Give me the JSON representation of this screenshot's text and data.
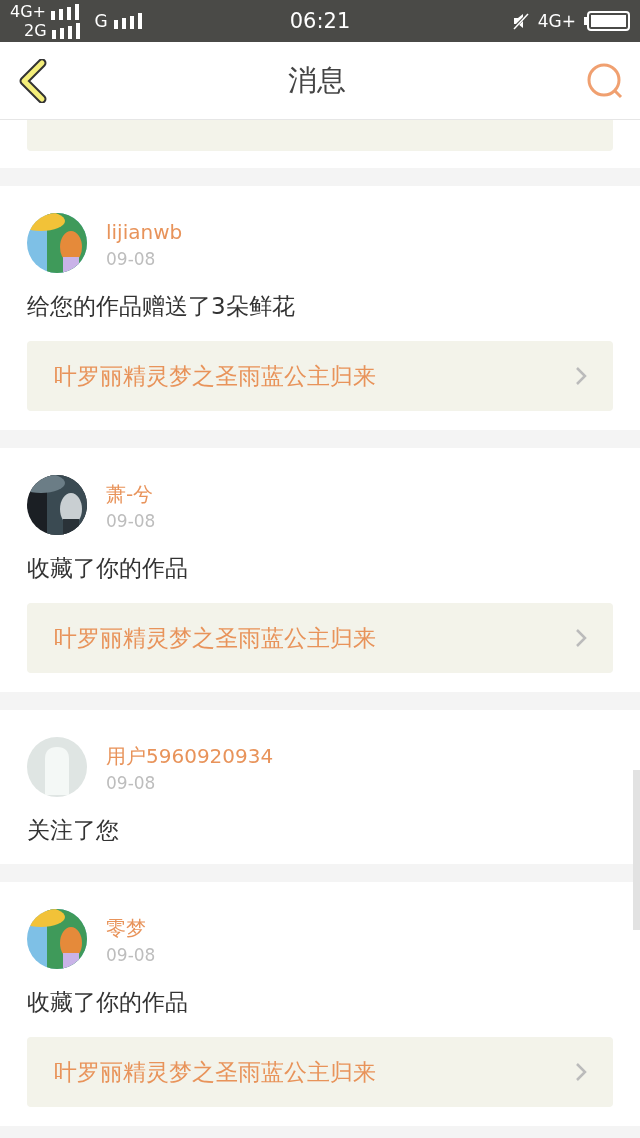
{
  "status_bar": {
    "sim1_network": "4G+",
    "sim2_network": "2G",
    "extra_network": "G",
    "time": "06:21",
    "data_network": "4G+"
  },
  "header": {
    "title": "消息"
  },
  "messages": [
    {
      "user": "lijianwb",
      "date": "09-08",
      "text": "给您的作品赠送了3朵鲜花",
      "work": "叶罗丽精灵梦之圣雨蓝公主归来"
    },
    {
      "user": "萧-兮",
      "date": "09-08",
      "text": "收藏了你的作品",
      "work": "叶罗丽精灵梦之圣雨蓝公主归来"
    },
    {
      "user": "用户5960920934",
      "avatar": {
        "kind": "placeholder"
      },
      "date": "09-08",
      "text": "关注了您"
    },
    {
      "user": "零梦",
      "date": "09-08",
      "text": "收藏了你的作品",
      "work": "叶罗丽精灵梦之圣雨蓝公主归来"
    }
  ]
}
